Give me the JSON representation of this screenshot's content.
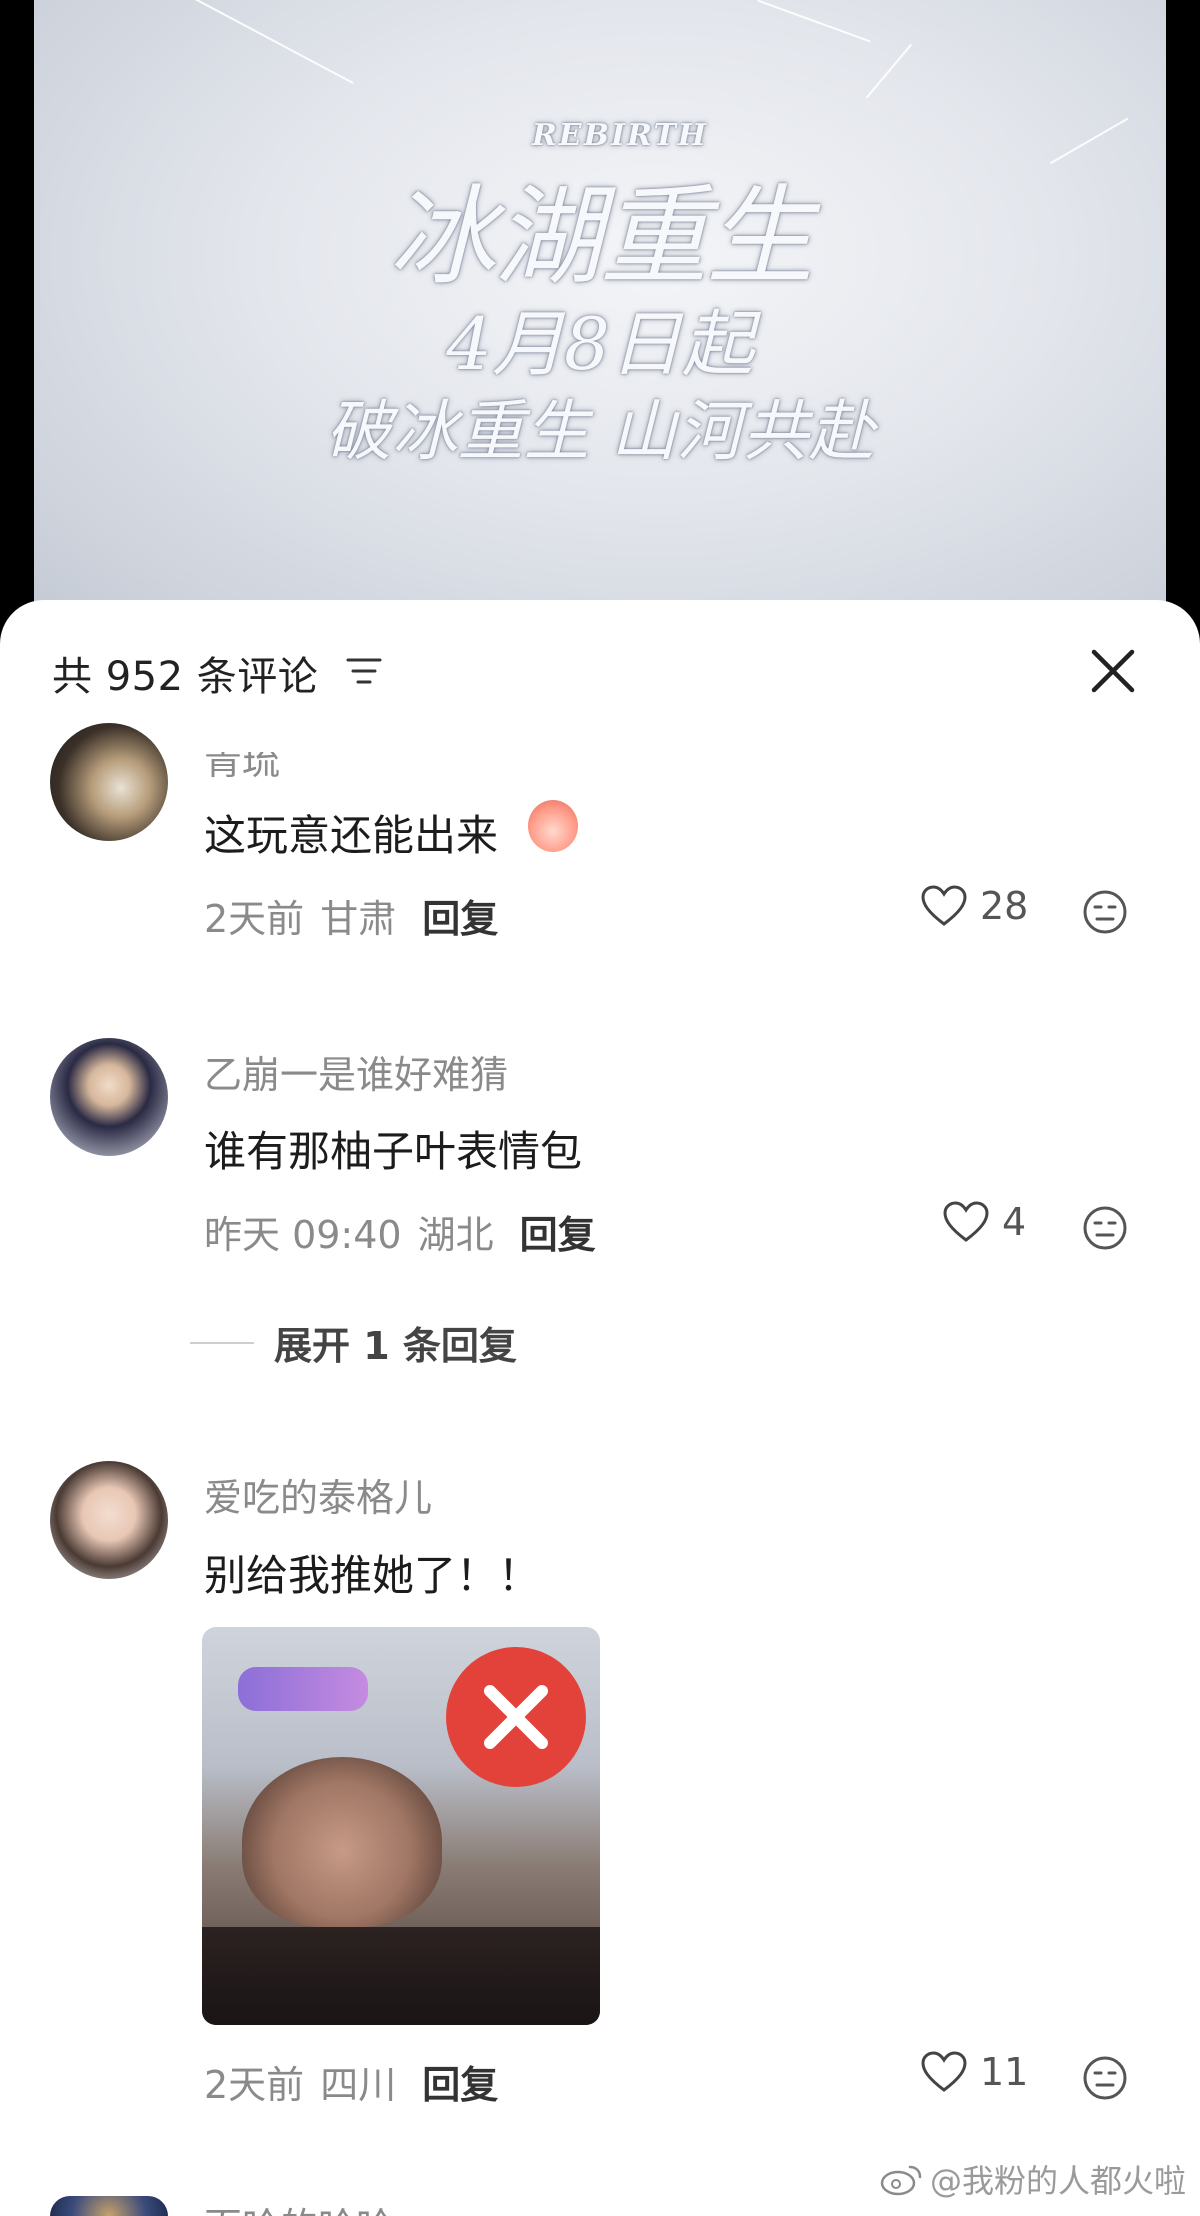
{
  "video": {
    "title_en": "REBIRTH",
    "title_cn": "冰湖重生",
    "date": "4月8日起",
    "slogan": "破冰重生 山河共赴"
  },
  "header": {
    "comment_count": "共 952 条评论"
  },
  "comments": [
    {
      "username": "青琉",
      "text": "这玩意还能出来",
      "time": "2天前",
      "location": "甘肃",
      "reply": "回复",
      "likes": "28"
    },
    {
      "username": "乙崩一是谁好难猜",
      "text": "谁有那柚子叶表情包",
      "time": "昨天 09:40",
      "location": "湖北",
      "reply": "回复",
      "likes": "4",
      "expand": "展开 1 条回复"
    },
    {
      "username": "爱吃的泰格儿",
      "text": "别给我推她了！！",
      "time": "2天前",
      "location": "四川",
      "reply": "回复",
      "likes": "11"
    },
    {
      "username": "百哈的哈哈"
    }
  ],
  "watermark": "@我粉的人都火啦",
  "colors": {
    "sheet_bg": "#ffffff",
    "muted_text": "#8a8a8a",
    "primary_text": "#1c1c1c"
  }
}
